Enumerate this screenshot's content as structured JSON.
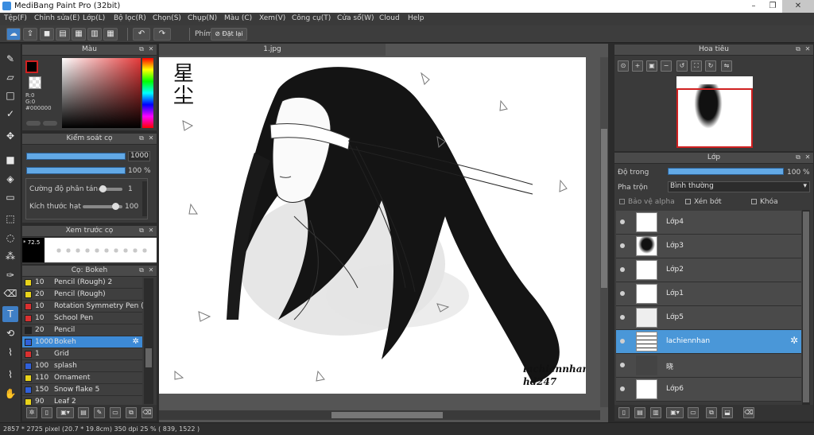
{
  "window": {
    "title": "MediBang Paint Pro (32bit)",
    "min": "–",
    "restore": "❐",
    "close": "✕"
  },
  "menu": [
    "Tệp(F)",
    "Chỉnh sửa(E)",
    "Lớp(L)",
    "Bộ lọc(R)",
    "Chọn(S)",
    "Chụp(N)",
    "Màu (C)",
    "Xem(V)",
    "Công cụ(T)",
    "Cửa sổ(W)",
    "Cloud",
    "Help"
  ],
  "toolbar": {
    "snap_label": "Phím",
    "reset_label": "Đặt lại"
  },
  "color_panel": {
    "title": "Màu",
    "r": "R:0",
    "g": "G:0",
    "hex": "#000000"
  },
  "brush_control": {
    "title": "Kiểm soát cọ",
    "size_value": "1000",
    "opacity_value": "100 %",
    "scatter_label": "Cường độ phân tán",
    "scatter_value": "1",
    "particle_label": "Kích thước hạt",
    "particle_value": "100"
  },
  "brush_preview": {
    "title": "Xem trước cọ",
    "size": "* 72.5"
  },
  "brush_list": {
    "title": "Cọ: Bokeh",
    "items": [
      {
        "size": "10",
        "name": "Pencil (Rough) 2",
        "color": "#e8d21a"
      },
      {
        "size": "20",
        "name": "Pencil (Rough)",
        "color": "#e8d21a"
      },
      {
        "size": "10",
        "name": "Rotation Symmetry Pen (Si",
        "color": "#d93030"
      },
      {
        "size": "10",
        "name": "School Pen",
        "color": "#d93030"
      },
      {
        "size": "20",
        "name": "Pencil",
        "color": "#222222"
      },
      {
        "size": "1000",
        "name": "Bokeh",
        "color": "#3060d8"
      },
      {
        "size": "1",
        "name": "Grid",
        "color": "#d93030"
      },
      {
        "size": "100",
        "name": "splash",
        "color": "#3060d8"
      },
      {
        "size": "110",
        "name": "Ornament",
        "color": "#e8d21a"
      },
      {
        "size": "150",
        "name": "Snow flake 5",
        "color": "#3060d8"
      },
      {
        "size": "90",
        "name": "Leaf 2",
        "color": "#e8d21a"
      }
    ]
  },
  "canvas": {
    "tab": "1.jpg",
    "chinese_title_1": "星",
    "chinese_title_2": "尘",
    "signature_1": "lachiennhan",
    "signature_2": "hd247"
  },
  "navigator": {
    "title": "Hoa tiêu"
  },
  "layers": {
    "title": "Lớp",
    "opacity_label": "Độ trong",
    "opacity_value": "100 %",
    "blend_label": "Pha trộn",
    "blend_value": "Bình thường",
    "protect_alpha": "Bảo vệ alpha",
    "clipping": "Xén bớt",
    "lock": "Khóa",
    "items": [
      "Lớp4",
      "Lớp3",
      "Lớp2",
      "Lớp1",
      "Lớp5",
      "lachiennhan",
      "晓",
      "Lớp6"
    ]
  },
  "status": {
    "text": "2857 * 2725 pixel   (20.7 * 19.8cm)   350 dpi   25 %   ( 839, 1522 )"
  }
}
